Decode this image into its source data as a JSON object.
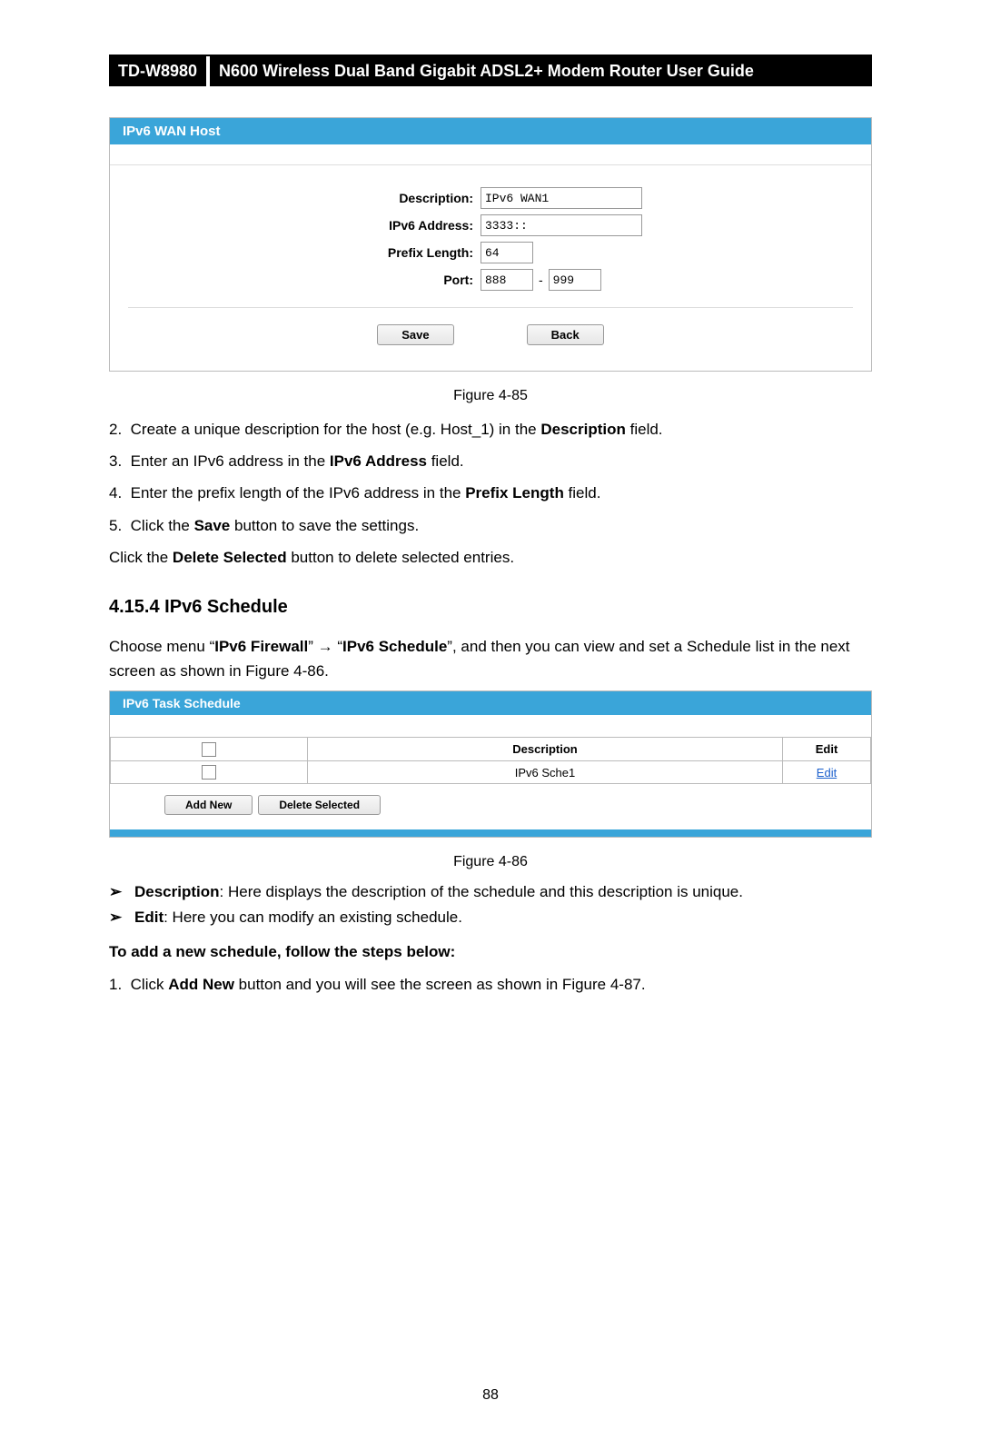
{
  "header": {
    "model": "TD-W8980",
    "title": "N600 Wireless Dual Band Gigabit ADSL2+ Modem Router User Guide"
  },
  "fig85": {
    "panel_title": "IPv6 WAN Host",
    "labels": {
      "description": "Description:",
      "ipv6_address": "IPv6 Address:",
      "prefix_length": "Prefix Length:",
      "port": "Port:"
    },
    "values": {
      "description": "IPv6 WAN1",
      "ipv6_address": "3333::",
      "prefix_length": "64",
      "port_from": "888",
      "port_to": "999"
    },
    "buttons": {
      "save": "Save",
      "back": "Back"
    },
    "caption": "Figure 4-85"
  },
  "steps85": [
    {
      "num": "2.",
      "prefix": "Create a unique description for the host (e.g. Host_1) in the ",
      "bold": "Description",
      "suffix": " field."
    },
    {
      "num": "3.",
      "prefix": "Enter an IPv6 address in the ",
      "bold": "IPv6 Address",
      "suffix": " field."
    },
    {
      "num": "4.",
      "prefix": "Enter the prefix length of the IPv6 address in the ",
      "bold": "Prefix Length",
      "suffix": " field."
    },
    {
      "num": "5.",
      "prefix": "Click the ",
      "bold": "Save",
      "suffix": " button to save the settings."
    }
  ],
  "delete_line": {
    "prefix": "Click the ",
    "bold": "Delete Selected",
    "suffix": " button to delete selected entries."
  },
  "section": {
    "number": "4.15.4",
    "title": "IPv6 Schedule"
  },
  "schedule_intro": {
    "p1a": "Choose menu “",
    "b1": "IPv6 Firewall",
    "p1b": "” → “",
    "b2": "IPv6 Schedule",
    "p1c": "”, and then you can view and set a Schedule list in the next screen as shown in Figure 4-86."
  },
  "fig86": {
    "panel_title": "IPv6 Task Schedule",
    "headers": {
      "description": "Description",
      "edit": "Edit"
    },
    "row": {
      "description": "IPv6 Sche1",
      "edit": "Edit"
    },
    "buttons": {
      "add_new": "Add New",
      "delete_selected": "Delete Selected"
    },
    "caption": "Figure 4-86"
  },
  "bullets": [
    {
      "bold": "Description",
      "text": ": Here displays the description of the schedule and this description is unique."
    },
    {
      "bold": "Edit",
      "text": ": Here you can modify an existing schedule."
    }
  ],
  "add_schedule_heading": "To add a new schedule, follow the steps below:",
  "add_steps": [
    {
      "num": "1.",
      "prefix": "Click ",
      "bold": "Add New",
      "suffix": " button and you will see the screen as shown in Figure 4-87."
    }
  ],
  "page_number": "88"
}
